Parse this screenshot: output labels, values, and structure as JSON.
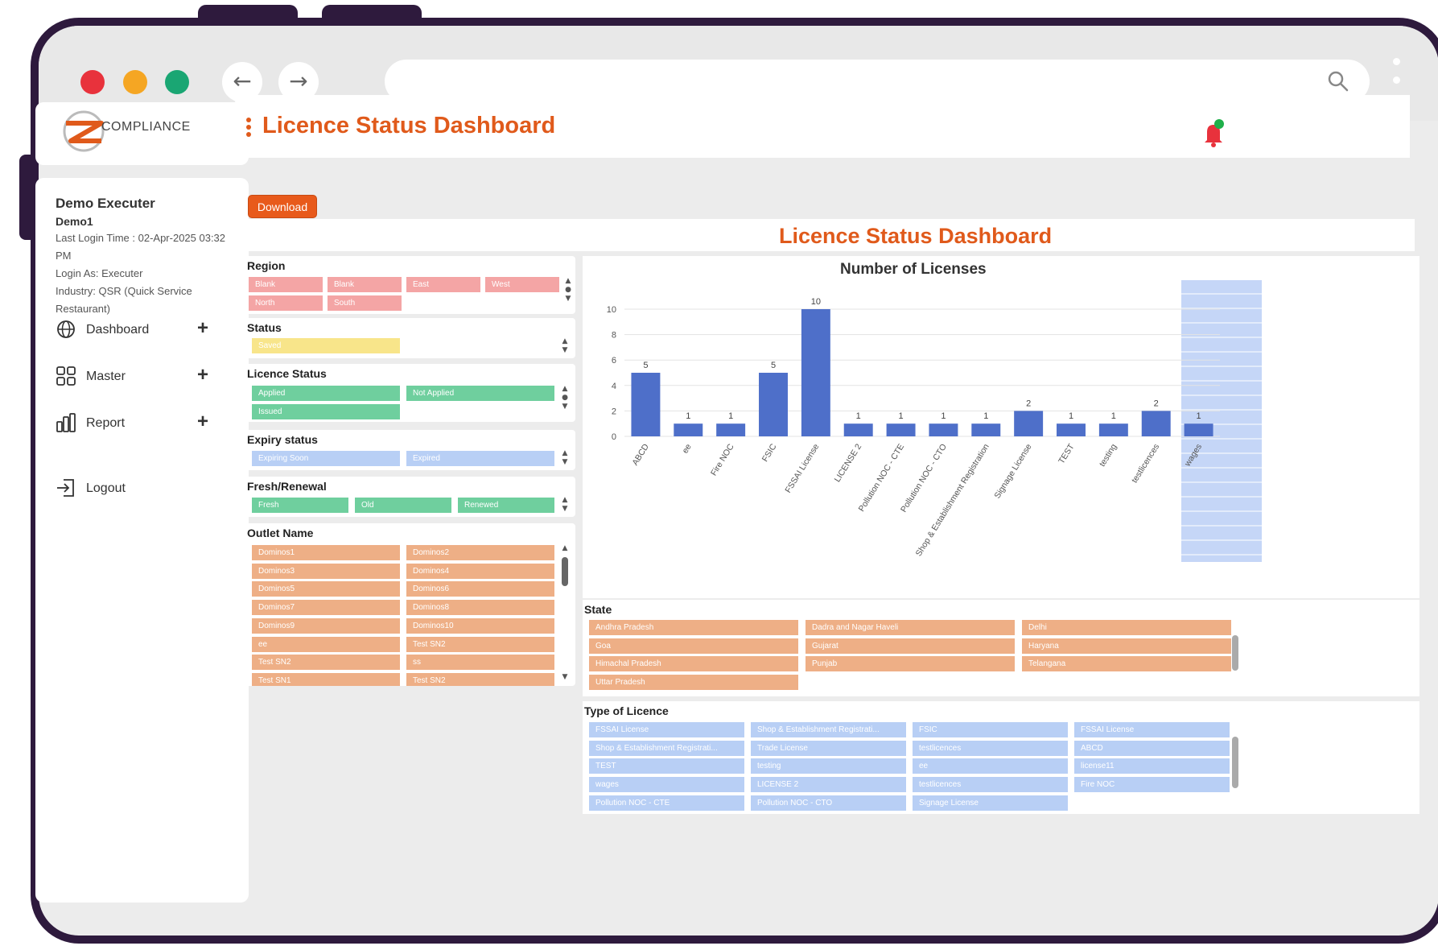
{
  "browser": {
    "url": "",
    "dot_colors": [
      "#e8323c",
      "#f5a623",
      "#1aa673"
    ]
  },
  "sidebar": {
    "logo_text": "COMPLIANCE",
    "user_name": "Demo Executer",
    "user_id": "Demo1",
    "last_login": "Last Login Time : 02-Apr-2025 03:32 PM",
    "login_as": "Login As: Executer",
    "industry": "Industry: QSR (Quick Service Restaurant)",
    "menu": [
      {
        "label": "Dashboard",
        "icon": "globe-icon"
      },
      {
        "label": "Master",
        "icon": "grid-icon"
      },
      {
        "label": "Report",
        "icon": "report-icon"
      },
      {
        "label": "Logout",
        "icon": "logout-icon"
      }
    ]
  },
  "header": {
    "title": "Licence Status Dashboard"
  },
  "toolbar": {
    "download_label": "Download"
  },
  "report": {
    "title": "Licence Status Dashboard"
  },
  "slicers": {
    "region": {
      "title": "Region",
      "items": [
        "Blank",
        "Blank",
        "East",
        "West",
        "North",
        "South"
      ]
    },
    "status": {
      "title": "Status",
      "items": [
        "Saved"
      ]
    },
    "licence_status": {
      "title": "Licence Status",
      "items": [
        "Applied",
        "Not Applied",
        "Issued"
      ]
    },
    "expiry_status": {
      "title": "Expiry status",
      "items": [
        "Expiring Soon",
        "Expired"
      ]
    },
    "fresh_renewal": {
      "title": "Fresh/Renewal",
      "items": [
        "Fresh",
        "Old",
        "Renewed"
      ]
    },
    "outlet_name": {
      "title": "Outlet Name",
      "items": [
        "Dominos1",
        "Dominos2",
        "Dominos3",
        "Dominos4",
        "Dominos5",
        "Dominos6",
        "Dominos7",
        "Dominos8",
        "Dominos9",
        "Dominos10",
        "ee",
        "Test SN2",
        "Test SN2",
        "ss",
        "Test SN1",
        "Test SN2"
      ]
    },
    "state": {
      "title": "State",
      "items": [
        "Andhra Pradesh",
        "Dadra and Nagar Haveli",
        "Delhi",
        "Goa",
        "Gujarat",
        "Haryana",
        "Himachal Pradesh",
        "Punjab",
        "Telangana",
        "Uttar Pradesh"
      ]
    },
    "type_of_licence": {
      "title": "Type of Licence",
      "items": [
        "FSSAI License",
        "Shop & Establishment Registrati...",
        "FSIC",
        "FSSAI License",
        "Shop & Establishment Registrati...",
        "Trade License",
        "testlicences",
        "ABCD",
        "TEST",
        "testing",
        "ee",
        "license11",
        "wages",
        "LICENSE 2",
        "testlicences",
        "Fire NOC",
        "Pollution NOC - CTE",
        "Pollution NOC - CTO",
        "Signage License"
      ]
    }
  },
  "chart_data": {
    "type": "bar",
    "title": "Number of Licenses",
    "categories": [
      "ABCD",
      "ee",
      "Fire NOC",
      "FSIC",
      "FSSAI License",
      "LICENSE 2",
      "Pollution NOC - CTE",
      "Pollution NOC - CTO",
      "Shop & Establishment Registration",
      "Signage License",
      "TEST",
      "testing",
      "testlicences",
      "wages"
    ],
    "values": [
      5,
      1,
      1,
      5,
      10,
      1,
      1,
      1,
      1,
      2,
      1,
      1,
      2,
      1
    ],
    "y_ticks": [
      0,
      2,
      4,
      6,
      8,
      10
    ],
    "ylim": [
      0,
      10
    ],
    "bar_color": "#4e6fc9",
    "grid": true
  },
  "colors": {
    "accent": "#e05a1b",
    "frame": "#2e1a3d"
  }
}
